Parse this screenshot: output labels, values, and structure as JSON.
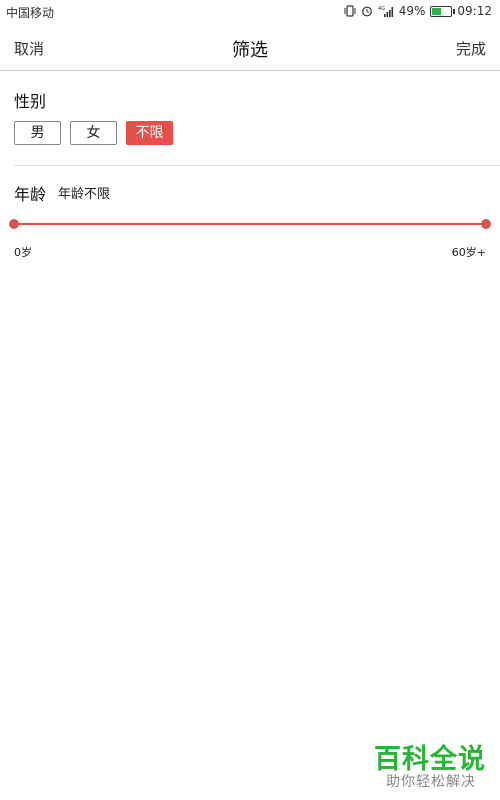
{
  "status_bar": {
    "carrier": "中国移动",
    "network": "4G",
    "battery_percent": "49%",
    "battery_level": 0.49,
    "time": "09:12",
    "icons": [
      "vibrate-icon",
      "alarm-icon",
      "signal-icon",
      "battery-icon"
    ]
  },
  "nav": {
    "cancel": "取消",
    "title": "筛选",
    "done": "完成"
  },
  "gender": {
    "title": "性别",
    "options": [
      "男",
      "女",
      "不限"
    ],
    "selected": "不限"
  },
  "age": {
    "title": "年龄",
    "value_text": "年龄不限",
    "min_label": "0岁",
    "max_label": "60岁+",
    "range_min": 0,
    "range_max": 60,
    "selected_min": 0,
    "selected_max": 60
  },
  "watermark": {
    "title": "百科全说",
    "subtitle": "助你轻松解决"
  },
  "colors": {
    "accent": "#e7504a",
    "watermark_green": "#27b534",
    "battery_green": "#2bb24c"
  }
}
